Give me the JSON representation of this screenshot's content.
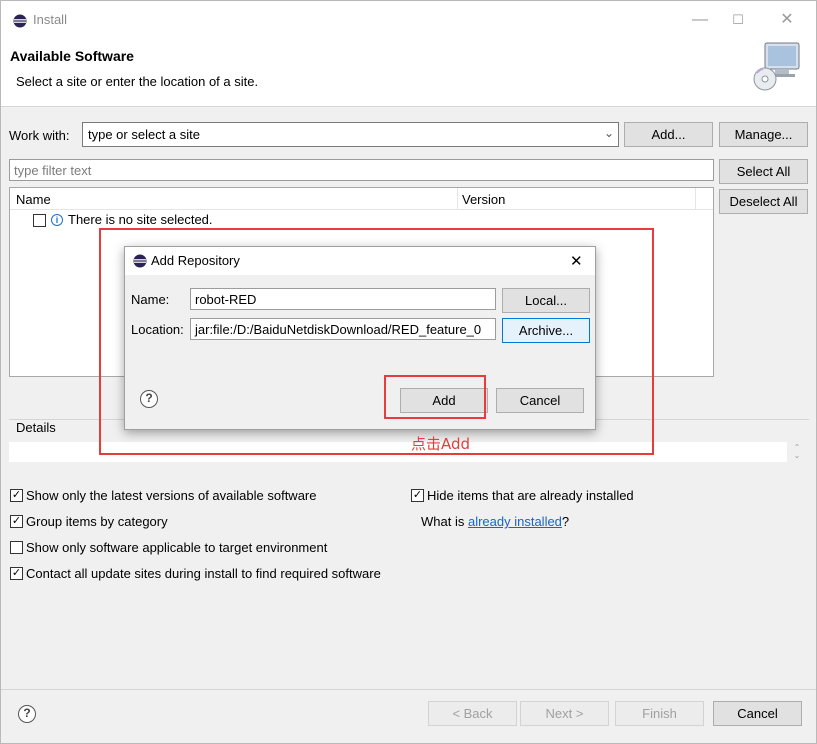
{
  "window": {
    "title": "Install",
    "minimize": "—",
    "maximize": "☐",
    "close": "✕"
  },
  "header": {
    "title": "Available Software",
    "description": "Select a site or enter the location of a site."
  },
  "work_with": {
    "label": "Work with:",
    "value": "type or select a site",
    "add_label": "Add...",
    "manage_label": "Manage..."
  },
  "filter": {
    "placeholder": "type filter text"
  },
  "select_all_label": "Select All",
  "deselect_all_label": "Deselect All",
  "tree": {
    "columns": [
      "Name",
      "Version"
    ],
    "rows": [
      {
        "label": "There is no site selected."
      }
    ]
  },
  "details": {
    "label": "Details"
  },
  "options": {
    "show_latest": {
      "label": "Show only the latest versions of available software",
      "checked": true
    },
    "group_by_category": {
      "label": "Group items by category",
      "checked": true
    },
    "target_env": {
      "label": "Show only software applicable to target environment",
      "checked": false
    },
    "contact_sites": {
      "label": "Contact all update sites during install to find required software",
      "checked": true
    },
    "hide_installed": {
      "label": "Hide items that are already installed",
      "checked": true
    },
    "what_is_prefix": "What is ",
    "what_is_link": "already installed",
    "what_is_suffix": "?"
  },
  "footer": {
    "back_label": "< Back",
    "next_label": "Next >",
    "finish_label": "Finish",
    "cancel_label": "Cancel"
  },
  "dialog": {
    "title": "Add Repository",
    "close": "✕",
    "name_label": "Name:",
    "name_value": "robot-RED",
    "location_label": "Location:",
    "location_value": "jar:file:/D:/BaiduNetdiskDownload/RED_feature_0",
    "local_label": "Local...",
    "archive_label": "Archive...",
    "add_label": "Add",
    "cancel_label": "Cancel"
  },
  "annotation": {
    "text": "点击Add",
    "color": "#e83b3b"
  }
}
